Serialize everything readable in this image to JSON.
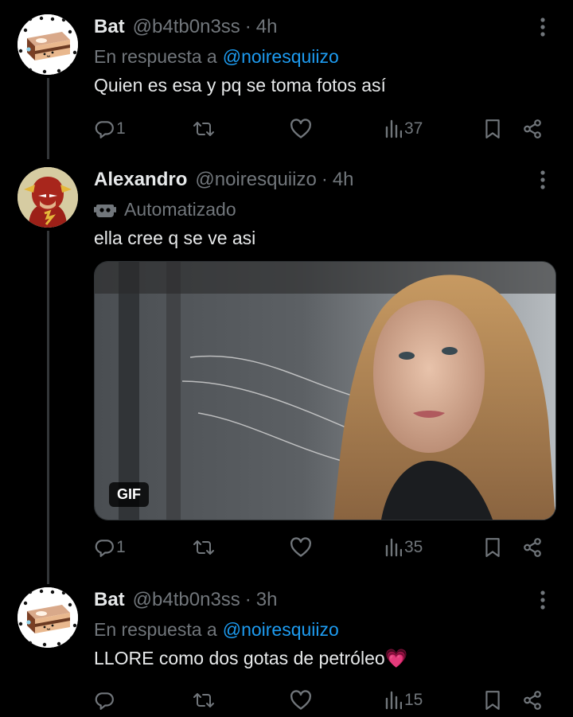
{
  "tweets": [
    {
      "name": "Bat",
      "handle": "@b4tb0n3ss",
      "sep": "·",
      "time": "4h",
      "reply_prefix": "En respuesta a",
      "reply_to": "@noiresquiizo",
      "text": "Quien es esa y pq se toma fotos así",
      "replies": "1",
      "reposts": "",
      "likes": "",
      "views": "37"
    },
    {
      "name": "Alexandro",
      "handle": "@noiresquiizo",
      "sep": "·",
      "time": "4h",
      "automated_label": "Automatizado",
      "text": "ella cree q se ve asi",
      "media_badge": "GIF",
      "replies": "1",
      "reposts": "",
      "likes": "",
      "views": "35"
    },
    {
      "name": "Bat",
      "handle": "@b4tb0n3ss",
      "sep": "·",
      "time": "3h",
      "reply_prefix": "En respuesta a",
      "reply_to": "@noiresquiizo",
      "text": "LLORE como dos gotas de petróleo💗",
      "replies": "",
      "reposts": "",
      "likes": "",
      "views": "15"
    }
  ],
  "icons": {
    "more": "more-dots-icon",
    "reply": "reply-icon",
    "repost": "repost-icon",
    "like": "heart-icon",
    "views": "views-icon",
    "bookmark": "bookmark-icon",
    "share": "share-icon",
    "automated": "robot-icon"
  },
  "colors": {
    "background": "#000000",
    "text": "#e7e9ea",
    "muted": "#71767b",
    "accent": "#1d9bf0",
    "thread_line": "#333639"
  }
}
